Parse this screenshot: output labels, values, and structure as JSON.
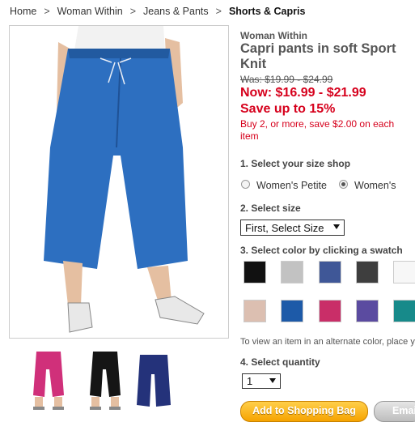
{
  "breadcrumb": {
    "items": [
      "Home",
      "Woman Within",
      "Jeans & Pants",
      "Shorts & Capris"
    ],
    "separator": ">"
  },
  "product": {
    "brand": "Woman Within",
    "title": "Capri pants in soft Sport Knit",
    "was_price": "Was: $19.99 - $24.99",
    "now_price": "Now: $16.99 - $21.99",
    "save_text": "Save up to 15%",
    "promo": "Buy 2, or more, save $2.00 on each item"
  },
  "steps": {
    "size_shop": {
      "label": "1. Select your size shop",
      "options": [
        "Women's Petite",
        "Women's"
      ],
      "selected": "Women's"
    },
    "size": {
      "label": "2. Select size",
      "value": "First, Select Size"
    },
    "color": {
      "label": "3. Select color by clicking a swatch",
      "swatches": [
        "#111111",
        "#c2c2c2",
        "#3f5797",
        "#3e3e3e",
        "#f7f7f7",
        "#dcbfb1",
        "#1d5aa8",
        "#c92e68",
        "#5b4ba0",
        "#178a8a"
      ]
    },
    "note": "To view an item in an alternate color, place yo",
    "quantity": {
      "label": "4. Select quantity",
      "value": "1"
    }
  },
  "buttons": {
    "add_to_bag": "Add to Shopping Bag",
    "email": "Emai"
  },
  "thumbnails": [
    "magenta",
    "black",
    "navy"
  ]
}
